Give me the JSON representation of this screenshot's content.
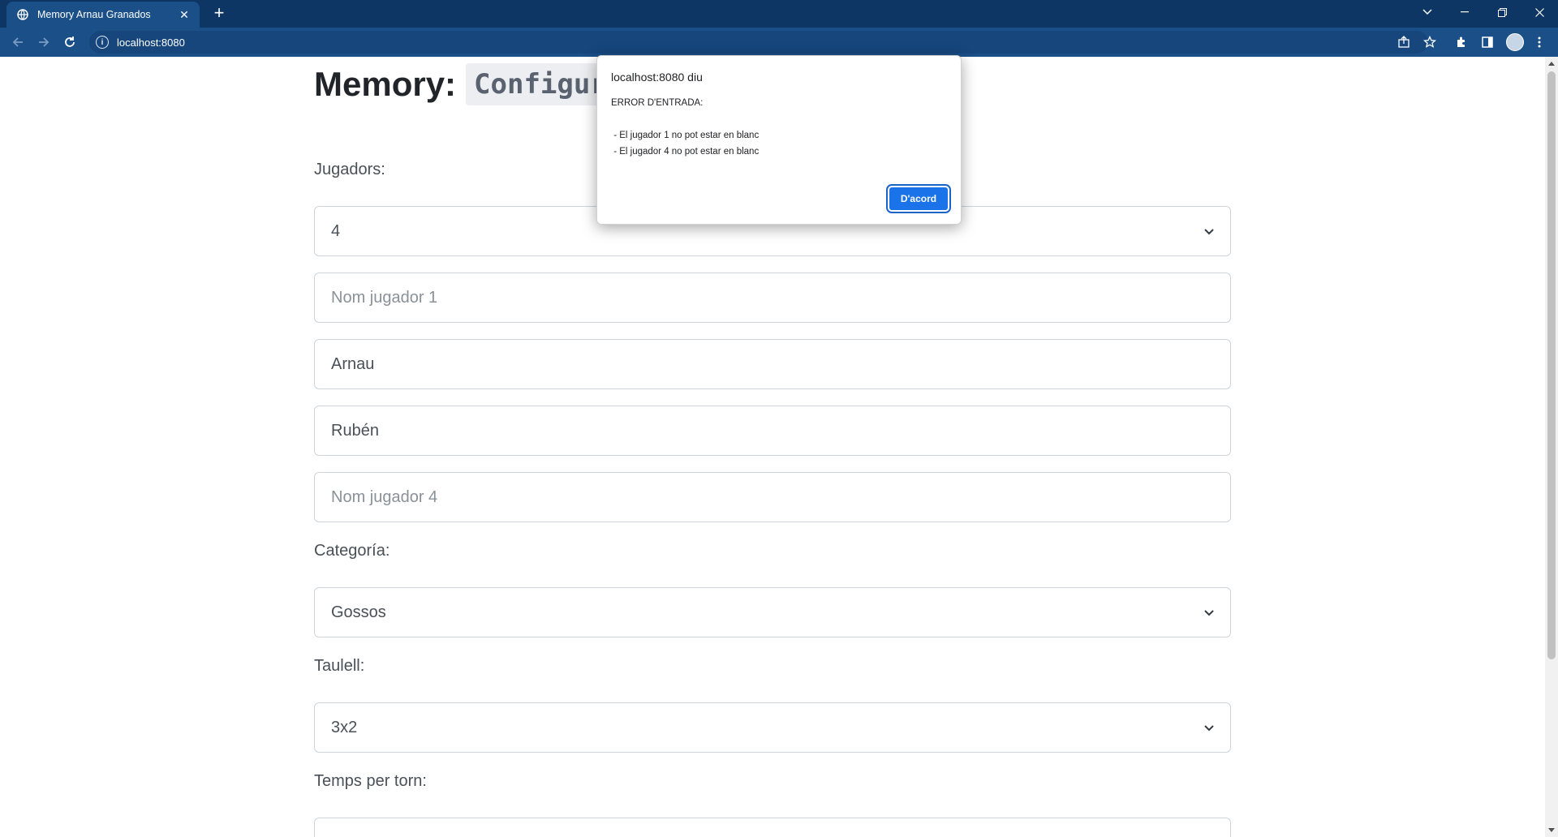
{
  "browser": {
    "tab_title": "Memory Arnau Granados",
    "url": "localhost:8080"
  },
  "page": {
    "heading": "Memory:",
    "heading_code": "Configur",
    "players_label": "Jugadors:",
    "players_value": "4",
    "player_fields": [
      {
        "value": "",
        "placeholder": "Nom jugador 1"
      },
      {
        "value": "Arnau",
        "placeholder": ""
      },
      {
        "value": "Rubén",
        "placeholder": ""
      },
      {
        "value": "",
        "placeholder": "Nom jugador 4"
      }
    ],
    "category_label": "Categoría:",
    "category_value": "Gossos",
    "board_label": "Taulell:",
    "board_value": "3x2",
    "time_label": "Temps per torn:"
  },
  "dialog": {
    "origin": "localhost:8080 diu",
    "message": "ERROR D'ENTRADA:\n\n - El jugador 1 no pot estar en blanc\n - El jugador 4 no pot estar en blanc",
    "ok_label": "D'acord"
  },
  "colors": {
    "chrome_dark": "#0d3664",
    "chrome_toolbar": "#1b4f87",
    "dialog_button": "#1a73e8"
  }
}
